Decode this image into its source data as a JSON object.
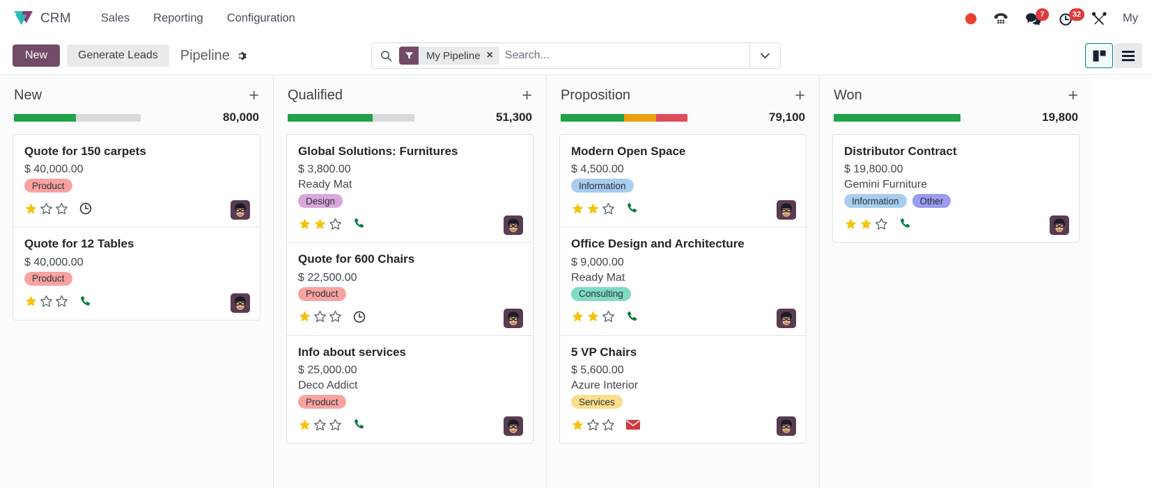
{
  "navbar": {
    "brand": "CRM",
    "links": [
      {
        "label": "Sales"
      },
      {
        "label": "Reporting"
      },
      {
        "label": "Configuration"
      }
    ],
    "icons": {
      "record_dot": "record-dot",
      "dialpad": "dialpad-icon",
      "messages": "chat-bubbles-icon",
      "messages_badge": "7",
      "activities": "clock-icon",
      "activities_badge": "32",
      "tools": "wrench-screwdriver-icon"
    },
    "user": "My"
  },
  "control_panel": {
    "new_label": "New",
    "generate_leads_label": "Generate Leads",
    "breadcrumb": "Pipeline",
    "gear": "gear-icon",
    "search": {
      "placeholder": "Search...",
      "value": "",
      "facet_label": "My Pipeline",
      "facet_remove": "×"
    },
    "views": {
      "kanban": "kanban-view-icon",
      "list": "list-view-icon"
    }
  },
  "colors": {
    "primary": "#714b67",
    "accent_teal": "#017e84",
    "green": "#21a34a",
    "orange": "#eba00c",
    "red": "#dd4c5d",
    "grey": "#d7d9dc",
    "star": "#f5c211",
    "phone": "#0b7c3f",
    "envelope": "#d4393f",
    "clock": "#2b2f36"
  },
  "columns": [
    {
      "title": "New",
      "total": "80,000",
      "segments": [
        {
          "color": "#21a34a",
          "pct": 49
        },
        {
          "color": "#d7d9dc",
          "pct": 51
        }
      ],
      "cards": [
        {
          "title": "Quote for 150 carpets",
          "amount": "$ 40,000.00",
          "partner": "",
          "tags": [
            {
              "label": "Product",
              "bg": "#f9a3a1",
              "fg": "#2b2f36"
            }
          ],
          "stars": 1,
          "star_total": 3,
          "activity": "clock",
          "avatar": "avatar"
        },
        {
          "title": "Quote for 12 Tables",
          "amount": "$ 40,000.00",
          "partner": "",
          "tags": [
            {
              "label": "Product",
              "bg": "#f9a3a1",
              "fg": "#2b2f36"
            }
          ],
          "stars": 1,
          "star_total": 3,
          "activity": "phone",
          "avatar": "avatar"
        }
      ]
    },
    {
      "title": "Qualified",
      "total": "51,300",
      "segments": [
        {
          "color": "#21a34a",
          "pct": 67
        },
        {
          "color": "#d7d9dc",
          "pct": 33
        }
      ],
      "cards": [
        {
          "title": "Global Solutions: Furnitures",
          "amount": "$ 3,800.00",
          "partner": "Ready Mat",
          "tags": [
            {
              "label": "Design",
              "bg": "#d9a7dc",
              "fg": "#2b2f36"
            }
          ],
          "stars": 2,
          "star_total": 3,
          "activity": "phone",
          "avatar": "avatar"
        },
        {
          "title": "Quote for 600 Chairs",
          "amount": "$ 22,500.00",
          "partner": "",
          "tags": [
            {
              "label": "Product",
              "bg": "#f9a3a1",
              "fg": "#2b2f36"
            }
          ],
          "stars": 1,
          "star_total": 3,
          "activity": "clock",
          "avatar": "avatar"
        },
        {
          "title": "Info about services",
          "amount": "$ 25,000.00",
          "partner": "Deco Addict",
          "tags": [
            {
              "label": "Product",
              "bg": "#f9a3a1",
              "fg": "#2b2f36"
            }
          ],
          "stars": 1,
          "star_total": 3,
          "activity": "phone",
          "avatar": "avatar"
        }
      ]
    },
    {
      "title": "Proposition",
      "total": "79,100",
      "segments": [
        {
          "color": "#21a34a",
          "pct": 50
        },
        {
          "color": "#eba00c",
          "pct": 25
        },
        {
          "color": "#dd4c5d",
          "pct": 25
        }
      ],
      "cards": [
        {
          "title": "Modern Open Space",
          "amount": "$ 4,500.00",
          "partner": "",
          "tags": [
            {
              "label": "Information",
              "bg": "#a8cdf0",
              "fg": "#2b2f36"
            }
          ],
          "stars": 2,
          "star_total": 3,
          "activity": "phone",
          "avatar": "avatar"
        },
        {
          "title": "Office Design and Architecture",
          "amount": "$ 9,000.00",
          "partner": "Ready Mat",
          "tags": [
            {
              "label": "Consulting",
              "bg": "#7fdbc4",
              "fg": "#2b2f36"
            }
          ],
          "stars": 2,
          "star_total": 3,
          "activity": "phone",
          "avatar": "avatar"
        },
        {
          "title": "5 VP Chairs",
          "amount": "$ 5,600.00",
          "partner": "Azure Interior",
          "tags": [
            {
              "label": "Services",
              "bg": "#fade8a",
              "fg": "#2b2f36"
            }
          ],
          "stars": 1,
          "star_total": 3,
          "activity": "envelope",
          "avatar": "avatar"
        }
      ]
    },
    {
      "title": "Won",
      "total": "19,800",
      "segments": [
        {
          "color": "#21a34a",
          "pct": 100
        }
      ],
      "cards": [
        {
          "title": "Distributor Contract",
          "amount": "$ 19,800.00",
          "partner": "Gemini Furniture",
          "tags": [
            {
              "label": "Information",
              "bg": "#a8cdf0",
              "fg": "#2b2f36"
            },
            {
              "label": "Other",
              "bg": "#9b9bf0",
              "fg": "#2b2f36"
            }
          ],
          "stars": 2,
          "star_total": 3,
          "activity": "phone",
          "avatar": "avatar"
        }
      ]
    }
  ]
}
